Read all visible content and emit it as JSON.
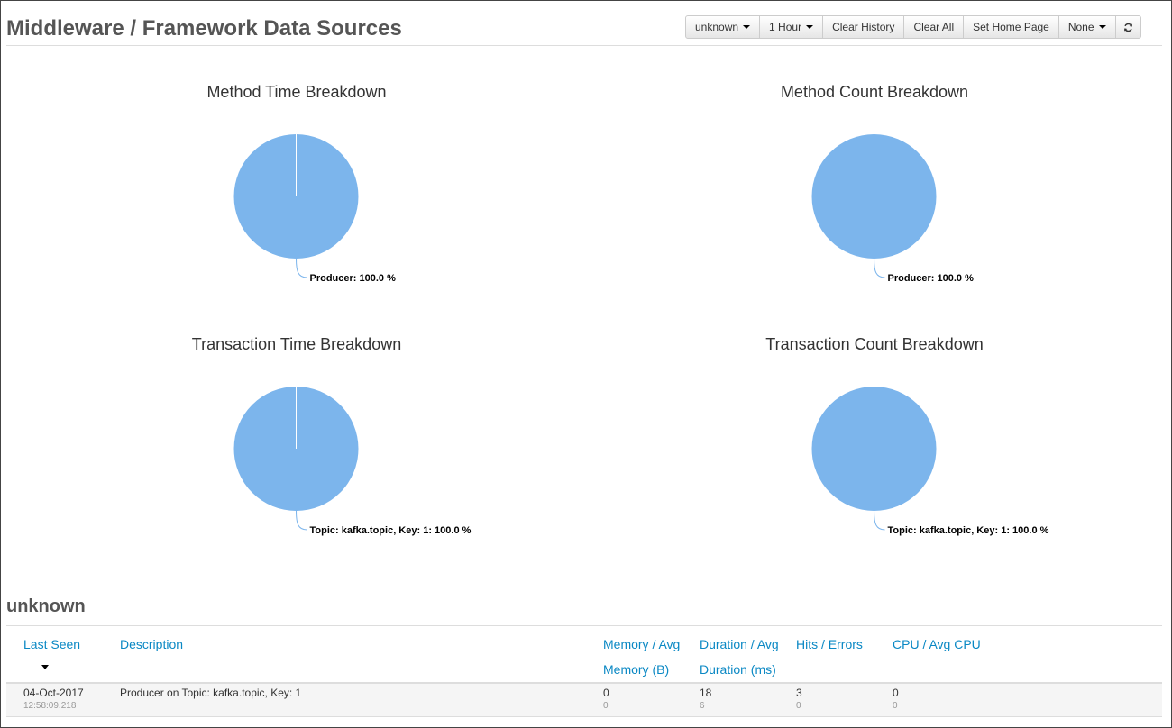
{
  "page": {
    "title": "Middleware / Framework Data Sources"
  },
  "toolbar": {
    "host_label": "unknown",
    "period_label": "1 Hour",
    "clear_history_label": "Clear History",
    "clear_all_label": "Clear All",
    "set_home_label": "Set Home Page",
    "none_label": "None"
  },
  "chart_data": [
    {
      "type": "pie",
      "title": "Method Time Breakdown",
      "slices": [
        {
          "label": "Producer: 100.0 %",
          "name": "Producer",
          "value": 100.0
        }
      ],
      "color": "#7cb5ec"
    },
    {
      "type": "pie",
      "title": "Method Count Breakdown",
      "slices": [
        {
          "label": "Producer: 100.0 %",
          "name": "Producer",
          "value": 100.0
        }
      ],
      "color": "#7cb5ec"
    },
    {
      "type": "pie",
      "title": "Transaction Time Breakdown",
      "slices": [
        {
          "label": "Topic: kafka.topic, Key: 1: 100.0 %",
          "name": "Topic: kafka.topic, Key: 1",
          "value": 100.0
        }
      ],
      "color": "#7cb5ec"
    },
    {
      "type": "pie",
      "title": "Transaction Count Breakdown",
      "slices": [
        {
          "label": "Topic: kafka.topic, Key: 1: 100.0 %",
          "name": "Topic: kafka.topic, Key: 1",
          "value": 100.0
        }
      ],
      "color": "#7cb5ec"
    }
  ],
  "section": {
    "title": "unknown"
  },
  "table": {
    "headers": {
      "last_seen": "Last Seen",
      "description": "Description",
      "memory": "Memory / Avg Memory (B)",
      "duration": "Duration / Avg Duration (ms)",
      "hits": "Hits / Errors",
      "cpu": "CPU / Avg CPU"
    },
    "rows": [
      {
        "date": "04-Oct-2017",
        "time": "12:58:09.218",
        "description": "Producer on Topic: kafka.topic, Key: 1",
        "memory": "0",
        "avg_memory": "0",
        "duration": "18",
        "avg_duration": "6",
        "hits": "3",
        "errors": "0",
        "cpu": "0",
        "avg_cpu": "0"
      }
    ]
  },
  "colors": {
    "accent": "#0a88c4",
    "pie": "#7cb5ec"
  }
}
